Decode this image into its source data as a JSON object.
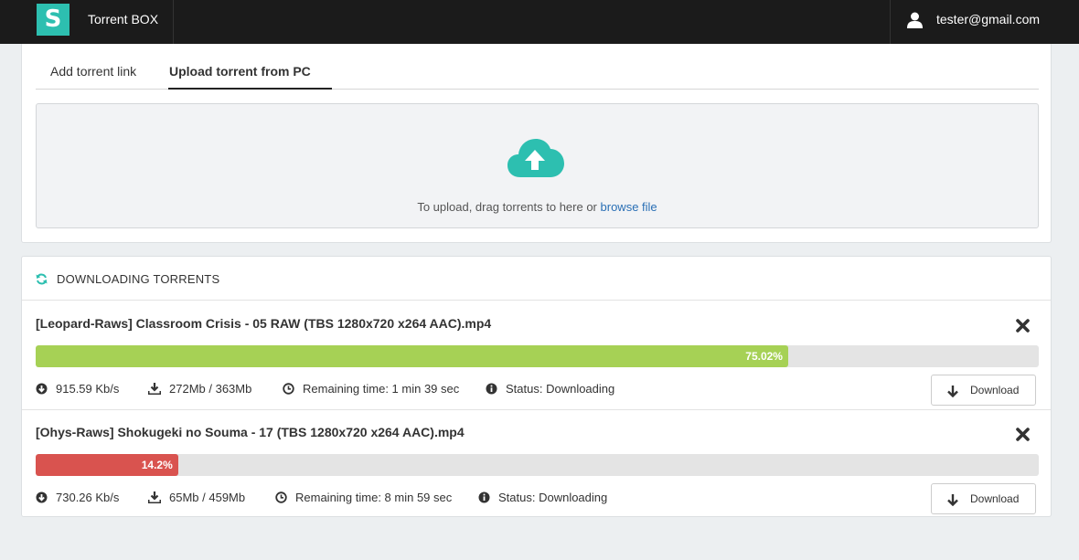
{
  "topbar": {
    "logo_letter": "S",
    "brand": "Torrent BOX",
    "user_email": "tester@gmail.com",
    "accent_color": "#2dbfb0"
  },
  "upload": {
    "tabs": [
      {
        "label": "Add torrent link",
        "active": false
      },
      {
        "label": "Upload torrent from PC",
        "active": true
      }
    ],
    "drop_text": "To upload, drag torrents to here or ",
    "browse_link": "browse file",
    "icon": "cloud-upload-icon"
  },
  "downloads": {
    "title": "DOWNLOADING TORRENTS",
    "items": [
      {
        "name": "[Leopard-Raws] Classroom Crisis - 05 RAW (TBS 1280x720 x264 AAC).mp4",
        "progress_percent": 75.02,
        "progress_label": "75.02%",
        "bar_color": "#a6d155",
        "speed": "915.59 Kb/s",
        "size": "272Mb / 363Mb",
        "remaining": "Remaining time: 1 min 39 sec",
        "status": "Status: Downloading",
        "download_label": "Download"
      },
      {
        "name": "[Ohys-Raws] Shokugeki no Souma - 17 (TBS 1280x720 x264 AAC).mp4",
        "progress_percent": 14.2,
        "progress_label": "14.2%",
        "bar_color": "#d9534f",
        "speed": "730.26 Kb/s",
        "size": "65Mb / 459Mb",
        "remaining": "Remaining time: 8 min 59 sec",
        "status": "Status: Downloading",
        "download_label": "Download"
      }
    ]
  }
}
